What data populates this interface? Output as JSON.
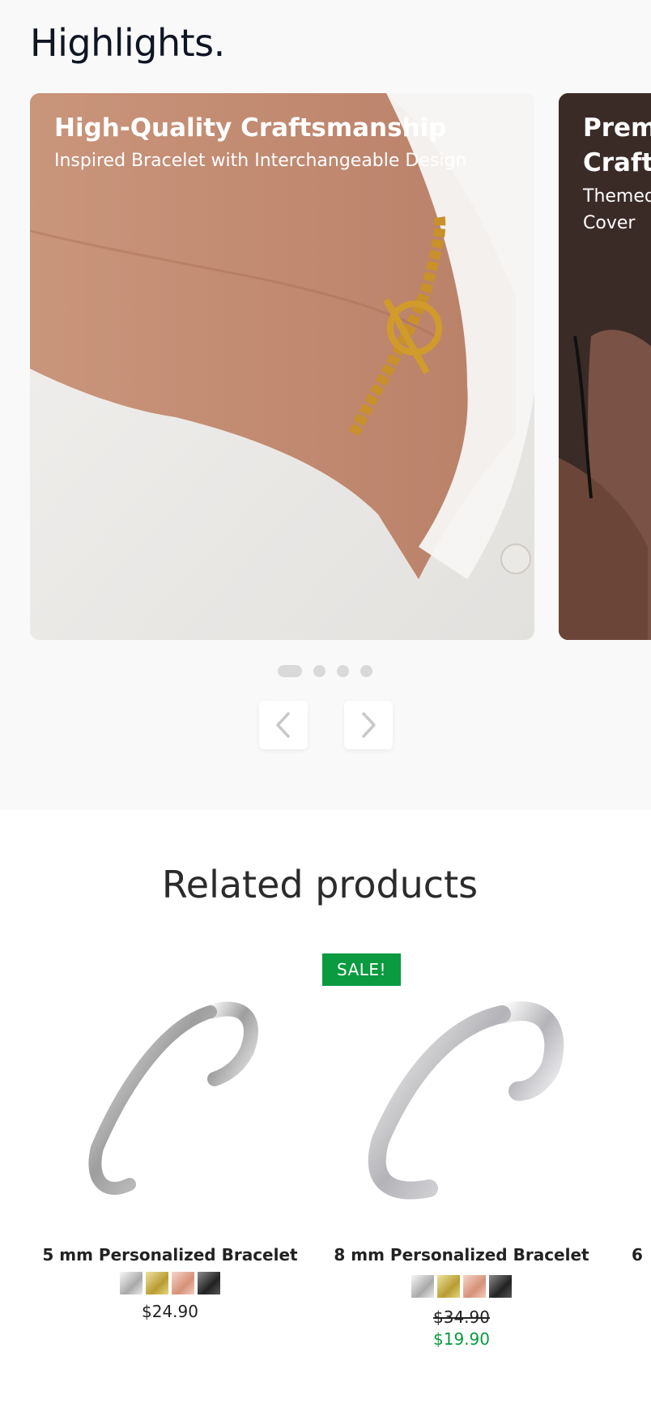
{
  "highlights": {
    "title": "Highlights.",
    "cards": [
      {
        "heading": "High-Quality Craftsmanship",
        "subtitle": "Inspired Bracelet with Interchangeable Design"
      },
      {
        "heading": "Premi Crafts",
        "subtitle": "Themed Cover"
      }
    ],
    "pagination": {
      "count": 4,
      "active": 1
    },
    "prev_icon": "chevron-left-icon",
    "next_icon": "chevron-right-icon"
  },
  "related": {
    "title": "Related products",
    "products": [
      {
        "name": "5 mm Personalized Bracelet",
        "price": "$24.90",
        "swatches": [
          "silver",
          "gold",
          "rose-gold",
          "black"
        ]
      },
      {
        "badge": "SALE!",
        "name": "8 mm Personalized Bracelet",
        "old_price": "$34.90",
        "sale_price": "$19.90",
        "swatches": [
          "silver",
          "gold",
          "rose-gold",
          "black"
        ]
      },
      {
        "name": "6"
      }
    ]
  },
  "colors": {
    "sale_green": "#0a9a3f",
    "title_dark": "#0f1523",
    "section_bg": "#f9f9fa"
  }
}
